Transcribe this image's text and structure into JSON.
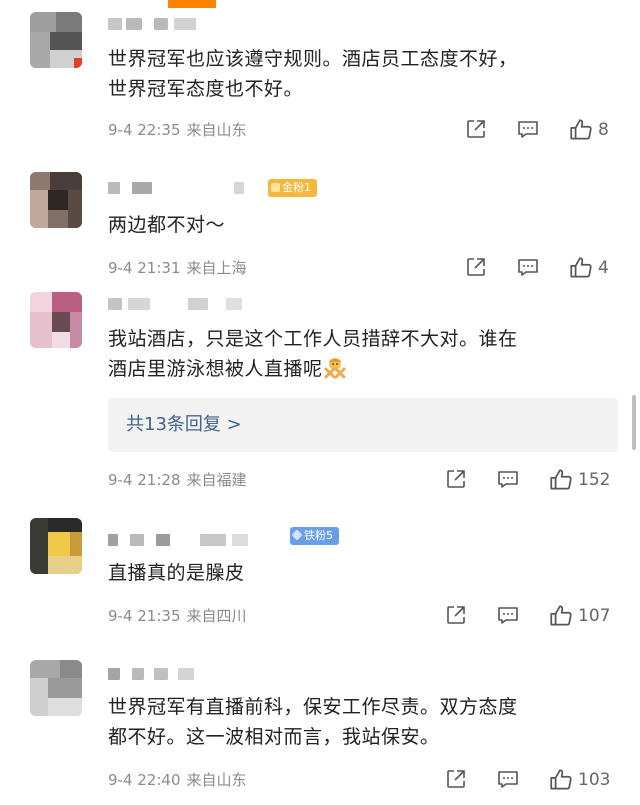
{
  "comments": [
    {
      "text_lines": [
        "世界冠军也应该遵守规则。酒店员工态度不好，",
        "世界冠军态度也不好。"
      ],
      "time": "9-4 22:35",
      "location": "来自山东",
      "likes": "8"
    },
    {
      "badge": "金粉1",
      "text_lines": [
        "两边都不对～"
      ],
      "time": "9-4 21:31",
      "location": "来自上海",
      "likes": "4"
    },
    {
      "text_lines": [
        "我站酒店，只是这个工作人员措辞不大对。谁在",
        "酒店里游泳想被人直播呢"
      ],
      "reply_link": "共13条回复 >",
      "time": "9-4 21:28",
      "location": "来自福建",
      "likes": "152"
    },
    {
      "badge": "铁粉5",
      "text_lines": [
        "直播真的是臊皮"
      ],
      "time": "9-4 21:35",
      "location": "来自四川",
      "likes": "107"
    },
    {
      "text_lines": [
        "世界冠军有直播前科，保安工作尽责。双方态度",
        "都不好。这一波相对而言，我站保安。"
      ],
      "time": "9-4 22:40",
      "location": "来自山东",
      "likes": "103"
    }
  ],
  "colors": {
    "text": "#222222",
    "meta": "#8b8b8b",
    "link": "#43638f",
    "badge_gold": "#f5b83d",
    "badge_iron": "#6a9fe8"
  },
  "icons": [
    "share-icon",
    "comment-icon",
    "like-icon",
    "person-gesturing-no-emoji"
  ]
}
